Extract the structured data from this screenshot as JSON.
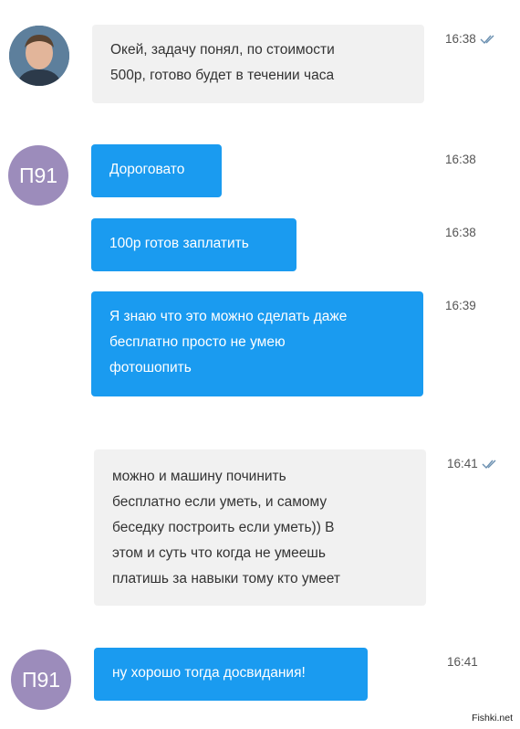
{
  "theme": {
    "incoming_bubble": "#f1f1f1",
    "outgoing_bubble": "#1a9bf0",
    "avatar_color": "#9c8cbb"
  },
  "messages": [
    {
      "text": "Окей, задачу понял, по стоимости\n500р, готово будет в течении часа",
      "time": "16:38",
      "read_icon": "double-check-icon"
    },
    {
      "text": "Дороговато",
      "time": "16:38"
    },
    {
      "text": "100р готов заплатить",
      "time": "16:38"
    },
    {
      "text": "Я знаю что это можно сделать даже\nбесплатно просто не умею\nфотошопить",
      "time": "16:39"
    },
    {
      "text": "можно и машину починить\nбесплатно если уметь, и самому\nбеседку построить если уметь)) В\nэтом и суть что когда не умеешь\nплатишь за навыки тому кто умеет",
      "time": "16:41",
      "read_icon": "double-check-icon"
    },
    {
      "text": "ну хорошо тогда досвидания!",
      "time": "16:41"
    }
  ],
  "avatars": {
    "contact_initials": "П91"
  },
  "watermark": "Fishki.net"
}
